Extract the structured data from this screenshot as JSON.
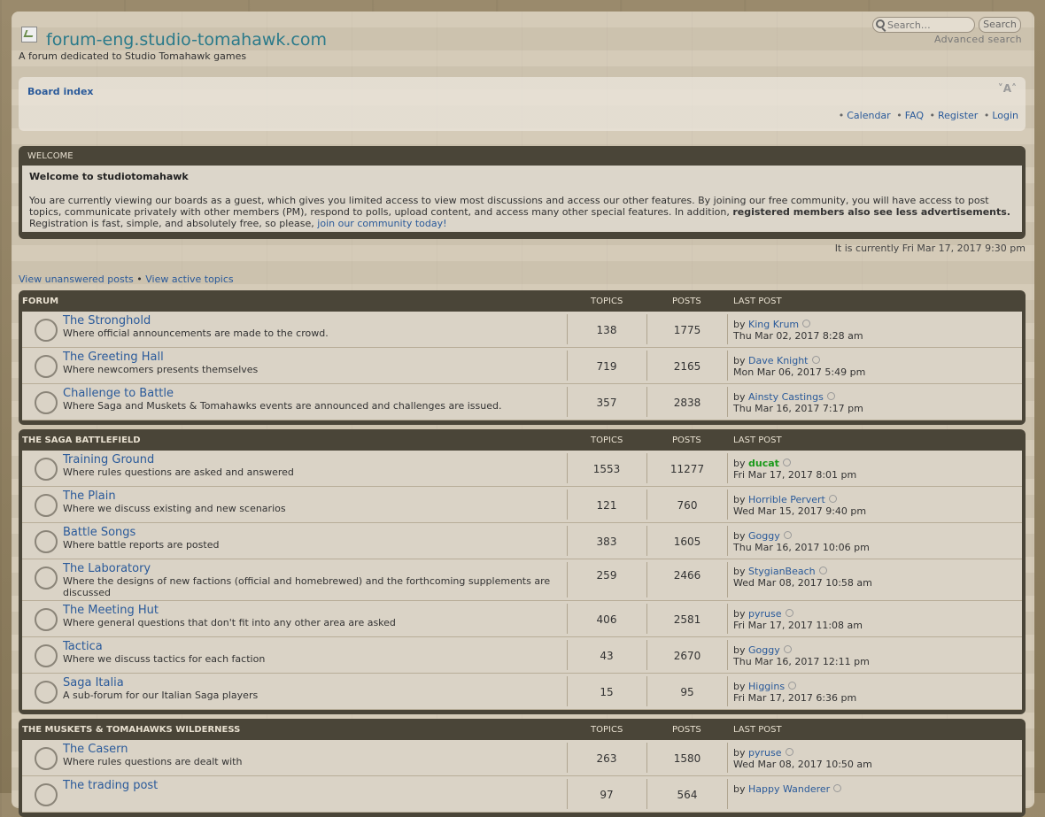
{
  "header": {
    "site_title": "forum-eng.studio-tomahawk.com",
    "site_desc": "A forum dedicated to Studio Tomahawk games",
    "search_placeholder": "Search…",
    "search_button": "Search",
    "advanced_search": "Advanced search"
  },
  "nav": {
    "board_index": "Board index",
    "font_size": "A",
    "links": [
      "Calendar",
      "FAQ",
      "Register",
      "Login"
    ]
  },
  "welcome": {
    "head": "WELCOME",
    "title": "Welcome to studiotomahawk",
    "text1": "You are currently viewing our boards as a guest, which gives you limited access to view most discussions and access our other features. By joining our free community, you will have access to post topics, communicate privately with other members (PM), respond to polls, upload content, and access many other special features. In addition, ",
    "bold": "registered members also see less advertisements.",
    "text2": " Registration is fast, simple, and absolutely free, so please, ",
    "link": "join our community today!"
  },
  "time": "It is currently Fri Mar 17, 2017 9:30 pm",
  "view_links": [
    "View unanswered posts",
    "View active topics"
  ],
  "columns": {
    "topics": "TOPICS",
    "posts": "POSTS",
    "last_post": "LAST POST"
  },
  "sections": [
    {
      "name": "FORUM",
      "forums": [
        {
          "title": "The Stronghold",
          "desc": "Where official announcements are made to the crowd.",
          "topics": "138",
          "posts": "1775",
          "by": "by",
          "author": "King Krum",
          "date": "Thu Mar 02, 2017 8:28 am"
        },
        {
          "title": "The Greeting Hall",
          "desc": "Where newcomers presents themselves",
          "topics": "719",
          "posts": "2165",
          "by": "by",
          "author": "Dave Knight",
          "date": "Mon Mar 06, 2017 5:49 pm"
        },
        {
          "title": "Challenge to Battle",
          "desc": "Where Saga and Muskets & Tomahawks events are announced and challenges are issued.",
          "topics": "357",
          "posts": "2838",
          "by": "by",
          "author": "Ainsty Castings",
          "date": "Thu Mar 16, 2017 7:17 pm"
        }
      ]
    },
    {
      "name": "THE SAGA BATTLEFIELD",
      "forums": [
        {
          "title": "Training Ground",
          "desc": "Where rules questions are asked and answered",
          "topics": "1553",
          "posts": "11277",
          "by": "by",
          "author": "ducat",
          "author_color": "#1a9a1a",
          "date": "Fri Mar 17, 2017 8:01 pm"
        },
        {
          "title": "The Plain",
          "desc": "Where we discuss existing and new scenarios",
          "topics": "121",
          "posts": "760",
          "by": "by",
          "author": "Horrible Pervert",
          "date": "Wed Mar 15, 2017 9:40 pm"
        },
        {
          "title": "Battle Songs",
          "desc": "Where battle reports are posted",
          "topics": "383",
          "posts": "1605",
          "by": "by",
          "author": "Goggy",
          "date": "Thu Mar 16, 2017 10:06 pm"
        },
        {
          "title": "The Laboratory",
          "desc": "Where the designs of new factions (official and homebrewed) and the forthcoming supplements are discussed",
          "topics": "259",
          "posts": "2466",
          "by": "by",
          "author": "StygianBeach",
          "date": "Wed Mar 08, 2017 10:58 am"
        },
        {
          "title": "The Meeting Hut",
          "desc": "Where general questions that don't fit into any other area are asked",
          "topics": "406",
          "posts": "2581",
          "by": "by",
          "author": "pyruse",
          "date": "Fri Mar 17, 2017 11:08 am"
        },
        {
          "title": "Tactica",
          "desc": "Where we discuss tactics for each faction",
          "topics": "43",
          "posts": "2670",
          "by": "by",
          "author": "Goggy",
          "date": "Thu Mar 16, 2017 12:11 pm"
        },
        {
          "title": "Saga Italia",
          "desc": "A sub-forum for our Italian Saga players",
          "topics": "15",
          "posts": "95",
          "by": "by",
          "author": "Higgins",
          "date": "Fri Mar 17, 2017 6:36 pm"
        }
      ]
    },
    {
      "name": "THE MUSKETS & TOMAHAWKS WILDERNESS",
      "forums": [
        {
          "title": "The Casern",
          "desc": "Where rules questions are dealt with",
          "topics": "263",
          "posts": "1580",
          "by": "by",
          "author": "pyruse",
          "date": "Wed Mar 08, 2017 10:50 am"
        },
        {
          "title": "The trading post",
          "desc": "",
          "topics": "97",
          "posts": "564",
          "by": "by",
          "author": "Happy Wanderer",
          "date": ""
        }
      ]
    }
  ]
}
